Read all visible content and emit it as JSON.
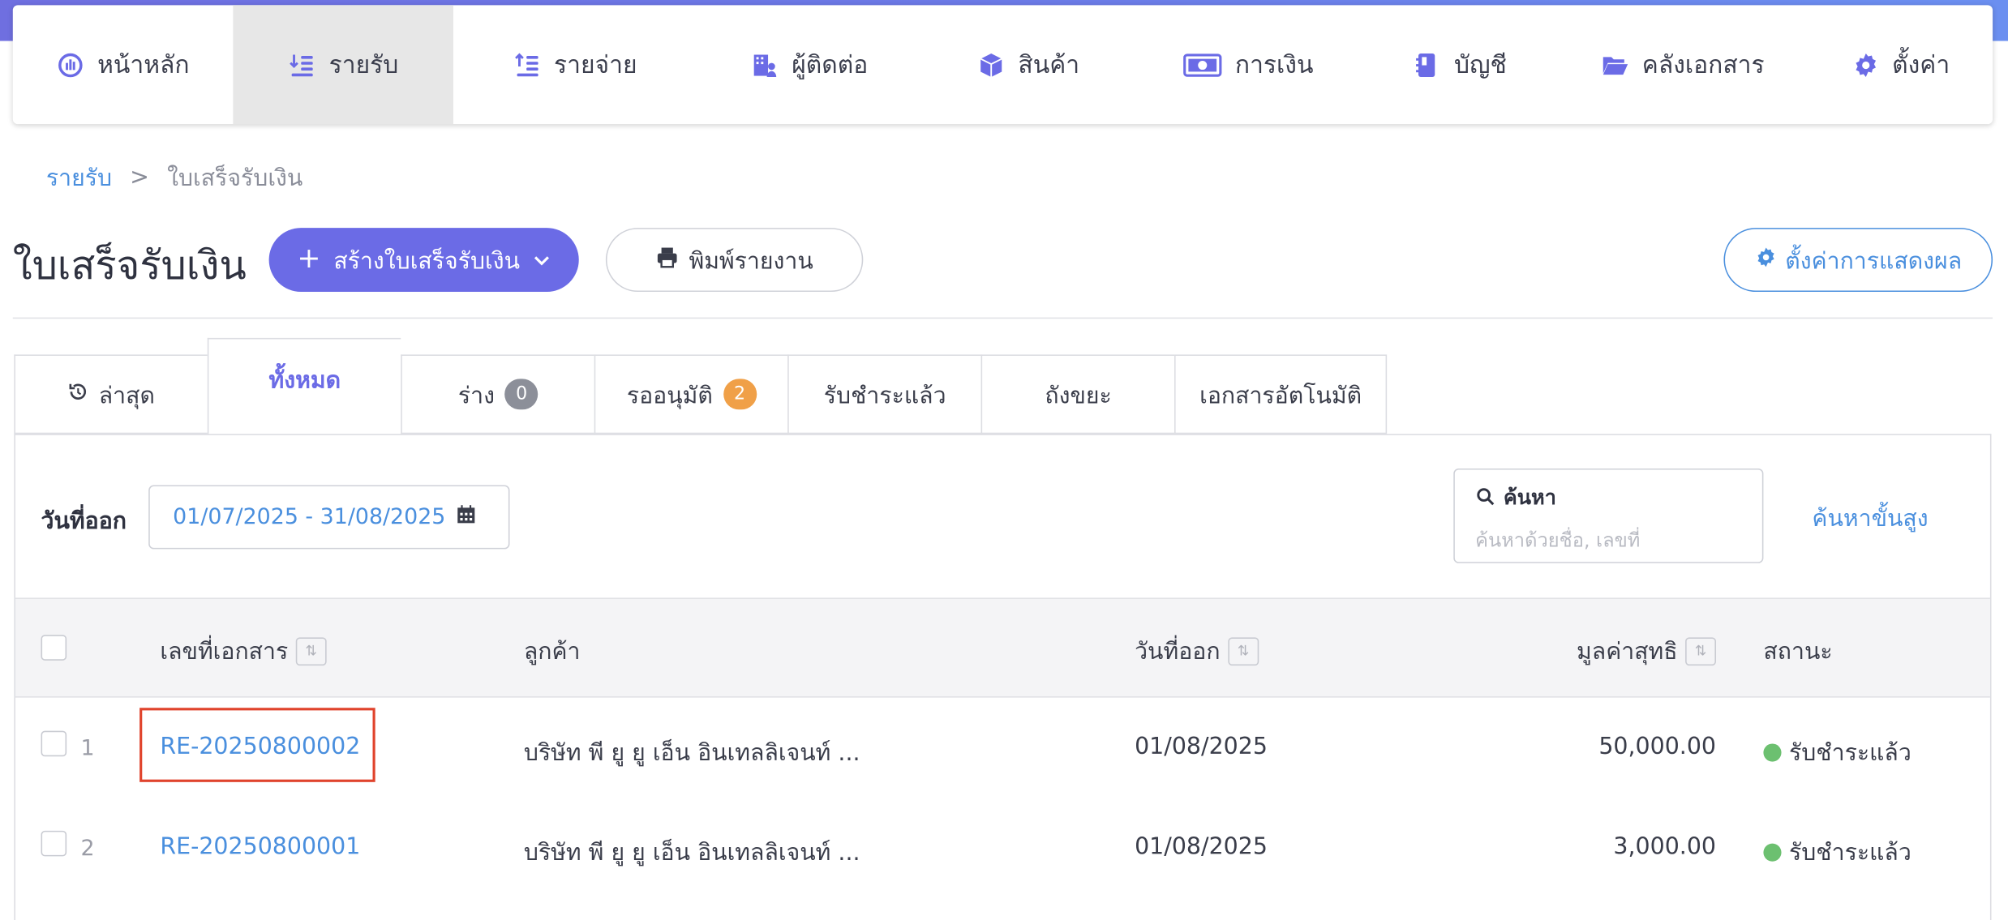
{
  "nav": {
    "items": [
      {
        "label": "หน้าหลัก",
        "icon": "dashboard-gauge-icon",
        "active": false
      },
      {
        "label": "รายรับ",
        "icon": "income-list-icon",
        "active": true
      },
      {
        "label": "รายจ่าย",
        "icon": "expense-list-icon",
        "active": false
      },
      {
        "label": "ผู้ติดต่อ",
        "icon": "contacts-building-icon",
        "active": false
      },
      {
        "label": "สินค้า",
        "icon": "product-box-icon",
        "active": false
      },
      {
        "label": "การเงิน",
        "icon": "money-bill-icon",
        "active": false
      },
      {
        "label": "บัญชี",
        "icon": "account-book-icon",
        "active": false
      },
      {
        "label": "คลังเอกสาร",
        "icon": "folder-open-icon",
        "active": false
      },
      {
        "label": "ตั้งค่า",
        "icon": "gear-icon",
        "active": false
      }
    ]
  },
  "breadcrumb": {
    "parent": "รายรับ",
    "separator": ">",
    "current": "ใบเสร็จรับเงิน"
  },
  "page": {
    "title": "ใบเสร็จรับเงิน",
    "create_button": "สร้างใบเสร็จรับเงิน",
    "print_button": "พิมพ์รายงาน",
    "display_settings_button": "ตั้งค่าการแสดงผล"
  },
  "tabs": [
    {
      "label": "ล่าสุด",
      "active": false
    },
    {
      "label": "ทั้งหมด",
      "active": true
    },
    {
      "label": "ร่าง",
      "badge": "0",
      "active": false
    },
    {
      "label": "รออนุมัติ",
      "badge": "2",
      "active": false
    },
    {
      "label": "รับชำระแล้ว",
      "active": false
    },
    {
      "label": "ถังขยะ",
      "active": false
    },
    {
      "label": "เอกสารอัตโนมัติ",
      "active": false
    }
  ],
  "filter": {
    "date_label": "วันที่ออก",
    "date_range": "01/07/2025 - 31/08/2025",
    "search_label": "ค้นหา",
    "search_placeholder": "ค้นหาด้วยชื่อ, เลขที่",
    "advanced_search": "ค้นหาขั้นสูง"
  },
  "table": {
    "columns": {
      "doc_no": "เลขที่เอกสาร",
      "customer": "ลูกค้า",
      "issue_date": "วันที่ออก",
      "net_value": "มูลค่าสุทธิ",
      "status": "สถานะ"
    },
    "rows": [
      {
        "num": "1",
        "doc_no": "RE-20250800002",
        "customer": "บริษัท พี ยู ยู เอ็น อินเทลลิเจนท์ ...",
        "issue_date": "01/08/2025",
        "net_value": "50,000.00",
        "status": "รับชำระแล้ว"
      },
      {
        "num": "2",
        "doc_no": "RE-20250800001",
        "customer": "บริษัท พี ยู ยู เอ็น อินเทลลิเจนท์ ...",
        "issue_date": "01/08/2025",
        "net_value": "3,000.00",
        "status": "รับชำระแล้ว"
      }
    ]
  },
  "colors": {
    "accent": "#6b6be6",
    "link": "#4a8fde",
    "status_paid": "#6cc070",
    "badge_orange": "#f0a048",
    "highlight": "#e0432c"
  }
}
